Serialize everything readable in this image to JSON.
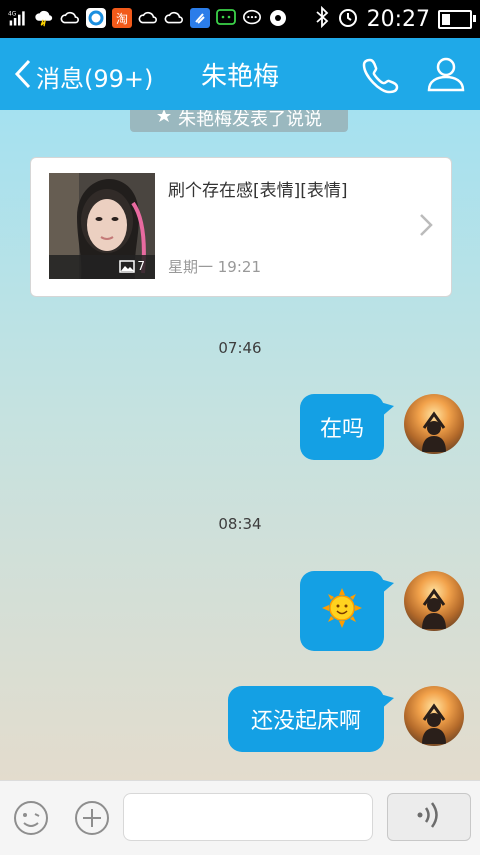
{
  "status_bar": {
    "network": "4G",
    "time": "20:27",
    "battery_level": 0.3,
    "icons": [
      "signal-icon",
      "weather-icon",
      "cloud-icon",
      "qq-browser-icon",
      "taobao-icon",
      "cloud-icon",
      "cloud-icon",
      "cleaner-icon",
      "wechat-icon",
      "message-icon",
      "music-icon",
      "bluetooth-icon",
      "alarm-icon",
      "battery-icon"
    ]
  },
  "header": {
    "back_label": "消息(99+)",
    "title": "朱艳梅",
    "call_icon": "phone-icon",
    "profile_icon": "person-icon"
  },
  "notice": {
    "text": "朱艳梅发表了说说"
  },
  "post_card": {
    "text": "刷个存在感[表情][表情]",
    "date": "星期一 19:21",
    "image_badge": "7"
  },
  "messages": [
    {
      "time": "07:46",
      "text": "在吗",
      "type": "text"
    },
    {
      "time": "08:34",
      "text": "",
      "type": "emoji",
      "emoji": "sun-emoji"
    },
    {
      "time": "",
      "text": "还没起床啊",
      "type": "text"
    }
  ],
  "input": {
    "placeholder": "",
    "value": ""
  },
  "colors": {
    "accent": "#1fa9e8",
    "bubble": "#14a0e4"
  }
}
